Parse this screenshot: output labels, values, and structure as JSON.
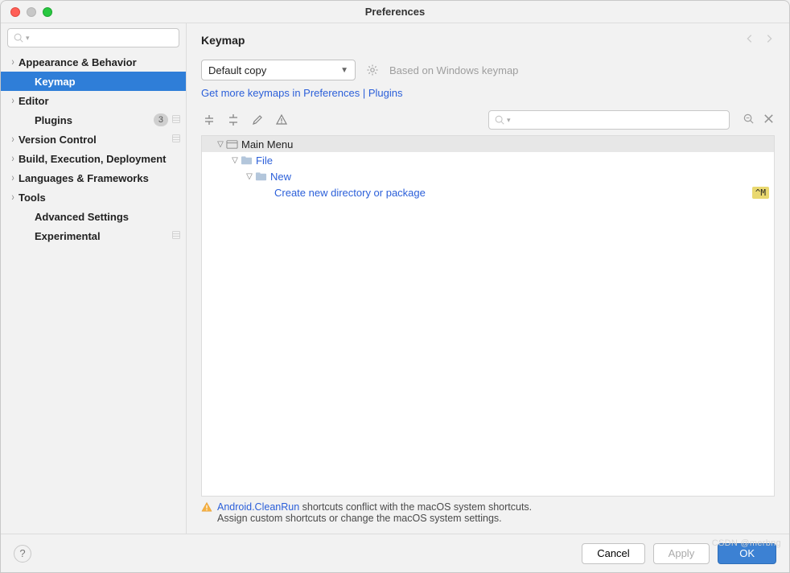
{
  "window_title": "Preferences",
  "sidebar": {
    "items": [
      {
        "label": "Appearance & Behavior",
        "expandable": true
      },
      {
        "label": "Keymap",
        "is_sub": true,
        "selected": true
      },
      {
        "label": "Editor",
        "expandable": true
      },
      {
        "label": "Plugins",
        "is_sub": true,
        "badge": "3",
        "has_cog": true
      },
      {
        "label": "Version Control",
        "expandable": true,
        "has_cog": true
      },
      {
        "label": "Build, Execution, Deployment",
        "expandable": true
      },
      {
        "label": "Languages & Frameworks",
        "expandable": true
      },
      {
        "label": "Tools",
        "expandable": true
      },
      {
        "label": "Advanced Settings",
        "is_sub": true
      },
      {
        "label": "Experimental",
        "is_sub": true,
        "has_cog": true
      }
    ]
  },
  "main": {
    "title": "Keymap",
    "keymap_select": "Default copy",
    "based_on": "Based on Windows keymap",
    "links": {
      "get_more": "Get more keymaps in Preferences | Plugins"
    },
    "tree": {
      "root": "Main Menu",
      "file": "File",
      "new": "New",
      "action": "Create new directory or package",
      "shortcut": "^M"
    },
    "warning": {
      "link": "Android.CleanRun",
      "rest": " shortcuts conflict with the macOS system shortcuts.",
      "sub": "Assign custom shortcuts or change the macOS system settings."
    }
  },
  "footer": {
    "cancel": "Cancel",
    "apply": "Apply",
    "ok": "OK"
  },
  "watermark": "CSDN @merbng"
}
